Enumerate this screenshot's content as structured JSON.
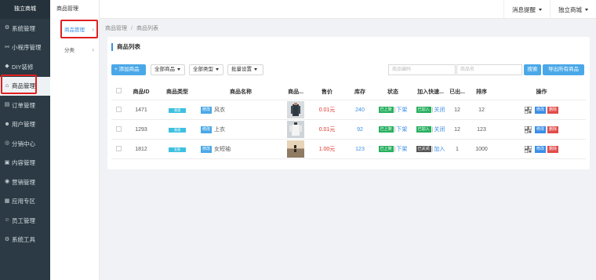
{
  "sidebar": {
    "brand": "独立商城",
    "items": [
      {
        "label": "系统管理",
        "icon": "gear-icon",
        "glyph": "⚙"
      },
      {
        "label": "小程序管理",
        "icon": "link-icon",
        "glyph": "⚯"
      },
      {
        "label": "DIY装修",
        "icon": "diamond-icon",
        "glyph": "◆"
      },
      {
        "label": "商品管理",
        "icon": "home-icon",
        "glyph": "⌂"
      },
      {
        "label": "订单管理",
        "icon": "document-icon",
        "glyph": "▤"
      },
      {
        "label": "用户管理",
        "icon": "user-icon",
        "glyph": "☻"
      },
      {
        "label": "分销中心",
        "icon": "share-icon",
        "glyph": "◎"
      },
      {
        "label": "内容管理",
        "icon": "content-icon",
        "glyph": "▣"
      },
      {
        "label": "营销管理",
        "icon": "marketing-icon",
        "glyph": "◉"
      },
      {
        "label": "应用专区",
        "icon": "apps-icon",
        "glyph": "▦"
      },
      {
        "label": "员工管理",
        "icon": "staff-icon",
        "glyph": "☺"
      },
      {
        "label": "系统工具",
        "icon": "tools-icon",
        "glyph": "⚙"
      }
    ]
  },
  "subnav": {
    "title": "商品管理",
    "items": [
      {
        "label": "商品管理",
        "chevron": "›"
      },
      {
        "label": "分类",
        "chevron": "›"
      }
    ]
  },
  "header": {
    "notify": "消息提醒",
    "store": "独立商城"
  },
  "breadcrumb": {
    "first": "商品管理",
    "sep": "/",
    "second": "商品列表"
  },
  "panel": {
    "title": "商品列表",
    "add_button": "+ 添加商品",
    "filter_all": "全部商品",
    "filter_type": "全部类型",
    "batch": "批量设置",
    "search_code_placeholder": "商品编码",
    "search_name_placeholder": "商品名",
    "search_button": "搜索",
    "export_button": "导出所有商品"
  },
  "table": {
    "headers": [
      "商品ID",
      "商品类型",
      "商品名称",
      "商品...",
      "售价",
      "库存",
      "状态",
      "加入快速...",
      "已出...",
      "排序",
      "操作"
    ],
    "rows": [
      {
        "id": "1471",
        "type_tag": "普通",
        "edit": "修改",
        "name": "风衣",
        "price": "0.01元",
        "stock": "240",
        "status_tag": "已上架",
        "status_action": "下架",
        "quick_tag": "已加入",
        "quick_action": "关闭",
        "sold": "12",
        "sort": "12",
        "op_edit": "修改",
        "op_delete": "删除",
        "thumb_icon": "product-thumbnail-coat"
      },
      {
        "id": "1293",
        "type_tag": "普通",
        "edit": "修改",
        "name": "上衣",
        "price": "0.01元",
        "stock": "92",
        "status_tag": "已上架",
        "status_action": "下架",
        "quick_tag": "已加入",
        "quick_action": "关闭",
        "sold": "12",
        "sort": "123",
        "op_edit": "修改",
        "op_delete": "删除",
        "thumb_icon": "product-thumbnail-shirt"
      },
      {
        "id": "1812",
        "type_tag": "女装",
        "edit": "修改",
        "name": "女短袖",
        "price": "1.00元",
        "stock": "123",
        "status_tag": "已上架",
        "status_action": "下架",
        "quick_tag": "已关闭",
        "quick_action": "加入",
        "sold": "1",
        "sort": "1000",
        "op_edit": "修改",
        "op_delete": "删除",
        "thumb_icon": "product-thumbnail-beach"
      }
    ]
  },
  "colors": {
    "sidebar_bg": "#2b3a44",
    "accent": "#3a8ee6",
    "primary_button": "#4aa8e8",
    "price_red": "#e0332a",
    "status_green": "#27b05f",
    "delete_red": "#e14b4b",
    "highlight_box": "#e02020"
  }
}
